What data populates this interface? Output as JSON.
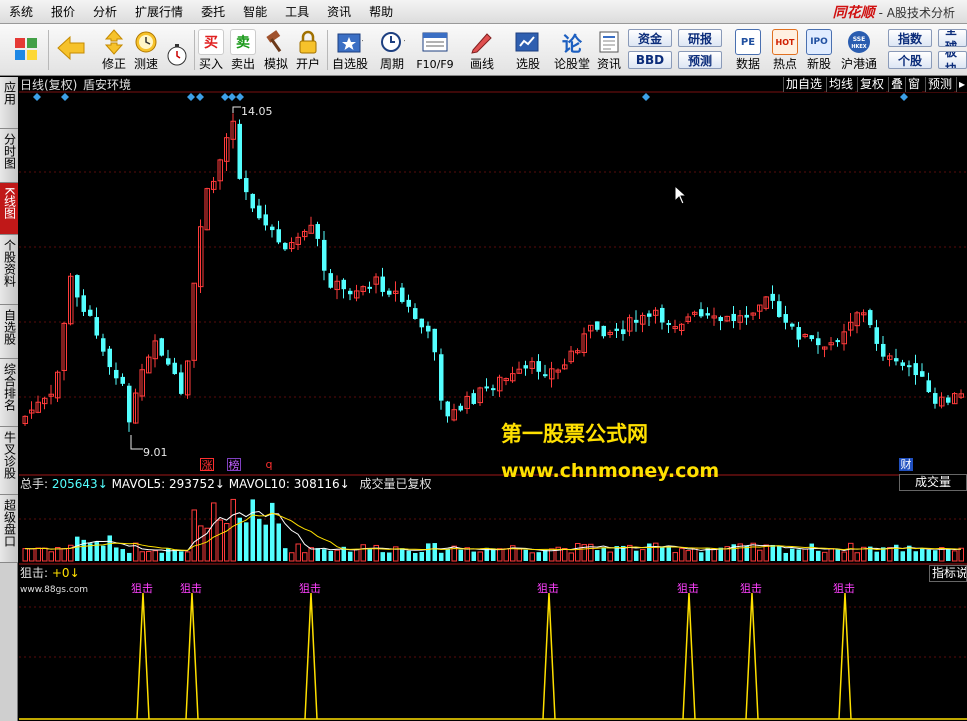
{
  "menu": [
    "系统",
    "报价",
    "分析",
    "扩展行情",
    "委托",
    "智能",
    "工具",
    "资讯",
    "帮助"
  ],
  "brand": {
    "logo": "同花顺",
    "subtitle": " - A股技术分析"
  },
  "toolbar": {
    "buttons": [
      {
        "label": "",
        "icon": "windows-icon"
      },
      {
        "label": "",
        "icon": "back-arrow-icon"
      },
      {
        "label": "修正",
        "icon": "up-down-arrow-icon"
      },
      {
        "label": "测速",
        "icon": "clock-icon"
      },
      {
        "label": "买入",
        "icon": "buy-icon",
        "glyph": "买"
      },
      {
        "label": "卖出",
        "icon": "sell-icon",
        "glyph": "卖"
      },
      {
        "label": "模拟",
        "icon": "hammer-icon"
      },
      {
        "label": "开户",
        "icon": "lock-icon"
      },
      {
        "label": "自选股",
        "icon": "star-folder-icon"
      },
      {
        "label": "周期",
        "icon": "cycle-icon"
      },
      {
        "label": "F10/F9",
        "icon": "f10-icon"
      },
      {
        "label": "画线",
        "icon": "pencil-icon"
      },
      {
        "label": "选股",
        "icon": "select-stock-icon"
      },
      {
        "label": "论股堂",
        "icon": "forum-icon"
      },
      {
        "label": "资讯",
        "icon": "news-icon"
      },
      {
        "label": "数据",
        "icon": "pe-icon",
        "glyph": "PE"
      },
      {
        "label": "热点",
        "icon": "hot-icon",
        "glyph": "HOT"
      },
      {
        "label": "新股",
        "icon": "ipo-icon",
        "glyph": "IPO"
      },
      {
        "label": "沪港通",
        "icon": "sse-hkex-icon"
      }
    ],
    "small_buttons": [
      "资金",
      "BBD",
      "研报",
      "预测",
      "指数",
      "个股",
      "全球",
      "板块"
    ]
  },
  "sidebar": [
    "应用",
    "分时图",
    "K线图",
    "个股资料",
    "自选股",
    "综合排名",
    "牛叉诊股",
    "超级盘口"
  ],
  "chart": {
    "title": "日线(复权)",
    "env": "盾安环境",
    "right_buttons": [
      "加自选",
      "均线",
      "复权",
      "叠",
      "窗",
      "预测"
    ],
    "high_label": "14.05",
    "low_label": "9.01",
    "flags": [
      {
        "text": "涨",
        "color": "#ff3030"
      },
      {
        "text": "榜",
        "color": "#c060ff"
      },
      {
        "text": "q",
        "color": "#ff3030"
      },
      {
        "text": "财",
        "color": "#4aa0ff"
      }
    ],
    "watermark_cn": "第一股票公式网",
    "watermark_url": "www.chnmoney.com"
  },
  "volume": {
    "label": "总手:",
    "value": "205643",
    "mavol5_label": "MAVOL5:",
    "mavol5": "293752",
    "mavol10_label": "MAVOL10:",
    "mavol10": "308116",
    "note": "成交量已复权",
    "panel_button": "成交量"
  },
  "indicator": {
    "label": "狙击:",
    "value": "+0",
    "panel_button": "指标说",
    "site": "www.88gs.com",
    "signal_text": "狙击",
    "signal_count": 7
  },
  "colors": {
    "up": "#ff3b3b",
    "down": "#54ffff",
    "accent_yellow": "#ffe000",
    "volume_label": "#54ffff",
    "signal": "#ff40ff"
  }
}
